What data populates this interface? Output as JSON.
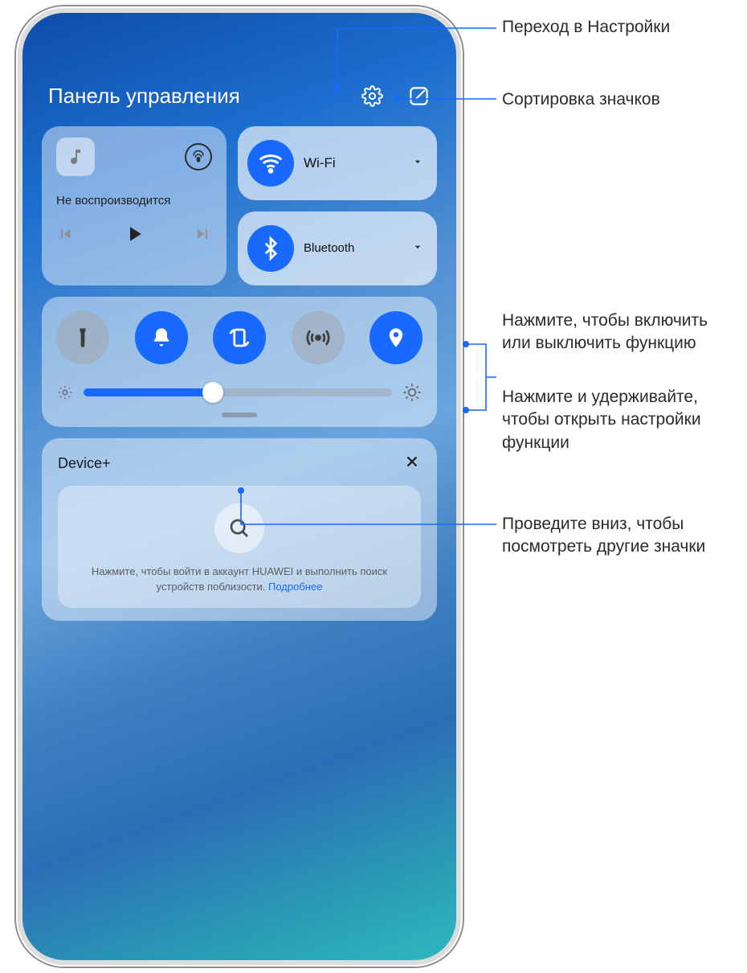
{
  "header": {
    "title": "Панель управления"
  },
  "media": {
    "status": "Не воспроизводится"
  },
  "conn": {
    "wifi": "Wi-Fi",
    "bluetooth": "Bluetooth"
  },
  "device": {
    "title": "Device+",
    "hint": "Нажмите, чтобы войти в аккаунт HUAWEI и выполнить поиск устройств поблизости. ",
    "more": "Подробнее"
  },
  "annotations": {
    "settings": "Переход в Настройки",
    "sort": "Сортировка значков",
    "tap": "Нажмите, чтобы включить или выключить функцию",
    "hold": "Нажмите и удерживайте, чтобы открыть настройки функции",
    "swipe": "Проведите вниз, чтобы посмотреть другие значки"
  },
  "brightness": {
    "percent": 42
  }
}
